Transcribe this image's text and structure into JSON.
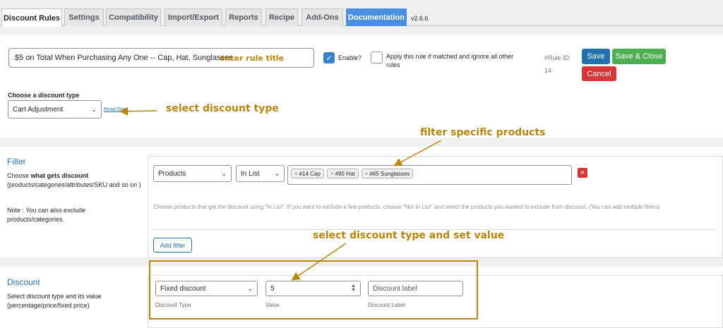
{
  "tabs": [
    {
      "label": "Discount Rules"
    },
    {
      "label": "Settings"
    },
    {
      "label": "Compatibility"
    },
    {
      "label": "Import/Export"
    },
    {
      "label": "Reports"
    },
    {
      "label": "Recipe"
    },
    {
      "label": "Add-Ons"
    },
    {
      "label": "Documentation"
    }
  ],
  "version": "v2.6.6",
  "rule": {
    "title_value": "$5 on Total When Purchasing Any One -- Cap, Hat, Sunglasses",
    "enable_label": "Enable?",
    "enable_checked": true,
    "apply_label": "Apply this rule if matched and ignore all other rules",
    "rule_id_label": "#Rule ID:",
    "rule_id_value": "14",
    "save_label": "Save",
    "save_close_label": "Save & Close",
    "cancel_label": "Cancel"
  },
  "discount_type": {
    "label": "Choose a discount type",
    "selected": "Cart Adjustment",
    "read_docs": "Read Docs"
  },
  "filter": {
    "title": "Filter",
    "desc_prefix": "Choose ",
    "desc_bold": "what gets discount",
    "desc_suffix": " (products/categories/attributes/SKU and so on )",
    "note": "Note : You can also exclude products/categories.",
    "type_selected": "Products",
    "operator_selected": "In List",
    "tags": [
      "#14 Cap",
      "#95 Hat",
      "#65 Sunglasses"
    ],
    "help_text": "Choose products that get the discount using \"In List\". If you want to exclude a few products, choose \"Not In List\" and select the products you wanted to exclude from discount. (You can add multiple filters)",
    "add_filter_label": "Add filter",
    "remove_icon": "×"
  },
  "discount": {
    "title": "Discount",
    "desc": "Select discount type and its value (percentage/price/fixed price)",
    "type_selected": "Fixed discount",
    "type_caption": "Discount Type",
    "value": "5",
    "value_caption": "Value",
    "label_placeholder": "Discount label",
    "label_caption": "Discount Label"
  },
  "annotations": {
    "rule_title": "enter rule title",
    "discount_type": "select discount type",
    "filter_products": "filter specific products",
    "discount_value": "select discount type and set value"
  },
  "colors": {
    "primary": "#2271b1",
    "success": "#4caf50",
    "danger": "#d63638",
    "annotation": "#b8860b",
    "documentation_tab": "#4a90e2"
  }
}
